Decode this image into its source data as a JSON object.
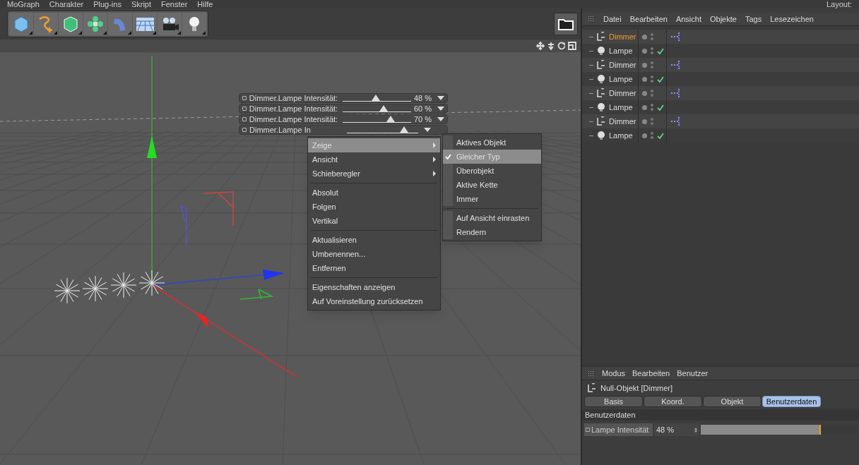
{
  "menu_bar": {
    "items": [
      "MoGraph",
      "Charakter",
      "Plug-ins",
      "Skript",
      "Fenster",
      "Hilfe"
    ],
    "layout_label": "Layout:"
  },
  "hud_sliders": [
    {
      "label": "Dimmer.Lampe Intensität:",
      "level": 0.48,
      "reading": "48 %"
    },
    {
      "label": "Dimmer.Lampe Intensität:",
      "level": 0.6,
      "reading": "60 %"
    },
    {
      "label": "Dimmer.Lampe Intensität:",
      "level": 0.7,
      "reading": "70 %"
    },
    {
      "label": "Dimmer.Lampe In",
      "level": 0.8
    }
  ],
  "context_menu": {
    "items": [
      {
        "kind": "submenu",
        "label": "Zeige",
        "highlighted": true
      },
      {
        "kind": "submenu",
        "label": "Ansicht",
        "highlighted": false
      },
      {
        "kind": "submenu",
        "label": "Schieberegler",
        "highlighted": false
      },
      {
        "kind": "separator"
      },
      {
        "kind": "item",
        "label": "Absolut",
        "highlighted": false
      },
      {
        "kind": "item",
        "label": "Folgen",
        "highlighted": false
      },
      {
        "kind": "item",
        "label": "Vertikal",
        "highlighted": false
      },
      {
        "kind": "separator"
      },
      {
        "kind": "item",
        "label": "Aktualisieren",
        "highlighted": false
      },
      {
        "kind": "item",
        "label": "Umbenennen...",
        "highlighted": false
      },
      {
        "kind": "item",
        "label": "Entfernen",
        "highlighted": false
      },
      {
        "kind": "separator"
      },
      {
        "kind": "item",
        "label": "Eigenschaften anzeigen",
        "highlighted": false
      },
      {
        "kind": "item",
        "label": "Auf Voreinstellung zurücksetzen",
        "highlighted": false
      }
    ]
  },
  "submenu": {
    "items": [
      {
        "kind": "item",
        "label": "Aktives Objekt",
        "checked": false,
        "highlighted": false
      },
      {
        "kind": "item",
        "label": "Gleicher Typ",
        "checked": true,
        "highlighted": true
      },
      {
        "kind": "item",
        "label": "Überobjekt",
        "checked": false,
        "highlighted": false
      },
      {
        "kind": "item",
        "label": "Aktive Kette",
        "checked": false,
        "highlighted": false
      },
      {
        "kind": "item",
        "label": "Immer",
        "checked": false,
        "highlighted": false
      },
      {
        "kind": "separator"
      },
      {
        "kind": "item",
        "label": "Auf Ansicht einrasten",
        "checked": false,
        "highlighted": false
      },
      {
        "kind": "item",
        "label": "Rendern",
        "checked": false,
        "highlighted": false
      }
    ]
  },
  "object_manager": {
    "menu": [
      "Datei",
      "Bearbeiten",
      "Ansicht",
      "Objekte",
      "Tags",
      "Lesezeichen"
    ],
    "objects": [
      {
        "kind": "null",
        "name": "Dimmer",
        "selected": true
      },
      {
        "kind": "light",
        "name": "Lampe",
        "selected": false,
        "enabled": true
      },
      {
        "kind": "null",
        "name": "Dimmer",
        "selected": false
      },
      {
        "kind": "light",
        "name": "Lampe",
        "selected": false,
        "enabled": true
      },
      {
        "kind": "null",
        "name": "Dimmer",
        "selected": false
      },
      {
        "kind": "light",
        "name": "Lampe",
        "selected": false,
        "enabled": true
      },
      {
        "kind": "null",
        "name": "Dimmer",
        "selected": false
      },
      {
        "kind": "light",
        "name": "Lampe",
        "selected": false,
        "enabled": true
      }
    ]
  },
  "attribute_manager": {
    "menu": [
      "Modus",
      "Bearbeiten",
      "Benutzer"
    ],
    "object_title": "Null-Objekt [Dimmer]",
    "tabs": [
      {
        "label": "Basis",
        "selected": false
      },
      {
        "label": "Koord.",
        "selected": false
      },
      {
        "label": "Objekt",
        "selected": false
      },
      {
        "label": "Benutzerdaten",
        "selected": true
      }
    ],
    "section": "Benutzerdaten",
    "parameter": {
      "label": "Lampe Intensität",
      "value": "48 %",
      "level": 0.77
    }
  }
}
